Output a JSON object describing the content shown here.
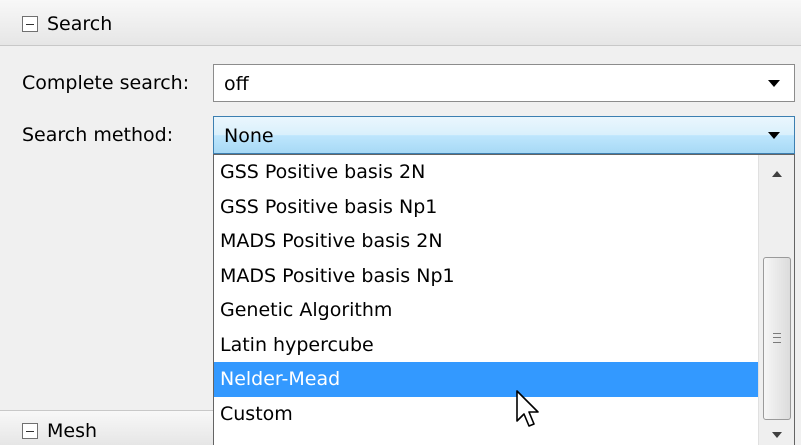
{
  "search_section": {
    "title": "Search",
    "collapse_icon": "minus-box-icon"
  },
  "complete_search": {
    "label": "Complete search:",
    "value": "off"
  },
  "search_method": {
    "label": "Search method:",
    "value": "None",
    "options": [
      "GSS Positive basis 2N",
      "GSS Positive basis Np1",
      "MADS Positive basis 2N",
      "MADS Positive basis Np1",
      "Genetic Algorithm",
      "Latin hypercube",
      "Nelder-Mead",
      "Custom"
    ],
    "highlighted_option": "Nelder-Mead"
  },
  "mesh_section": {
    "title": "Mesh",
    "collapse_icon": "minus-box-icon"
  },
  "colors": {
    "highlight": "#3399ff",
    "background": "#f0f0f0"
  }
}
